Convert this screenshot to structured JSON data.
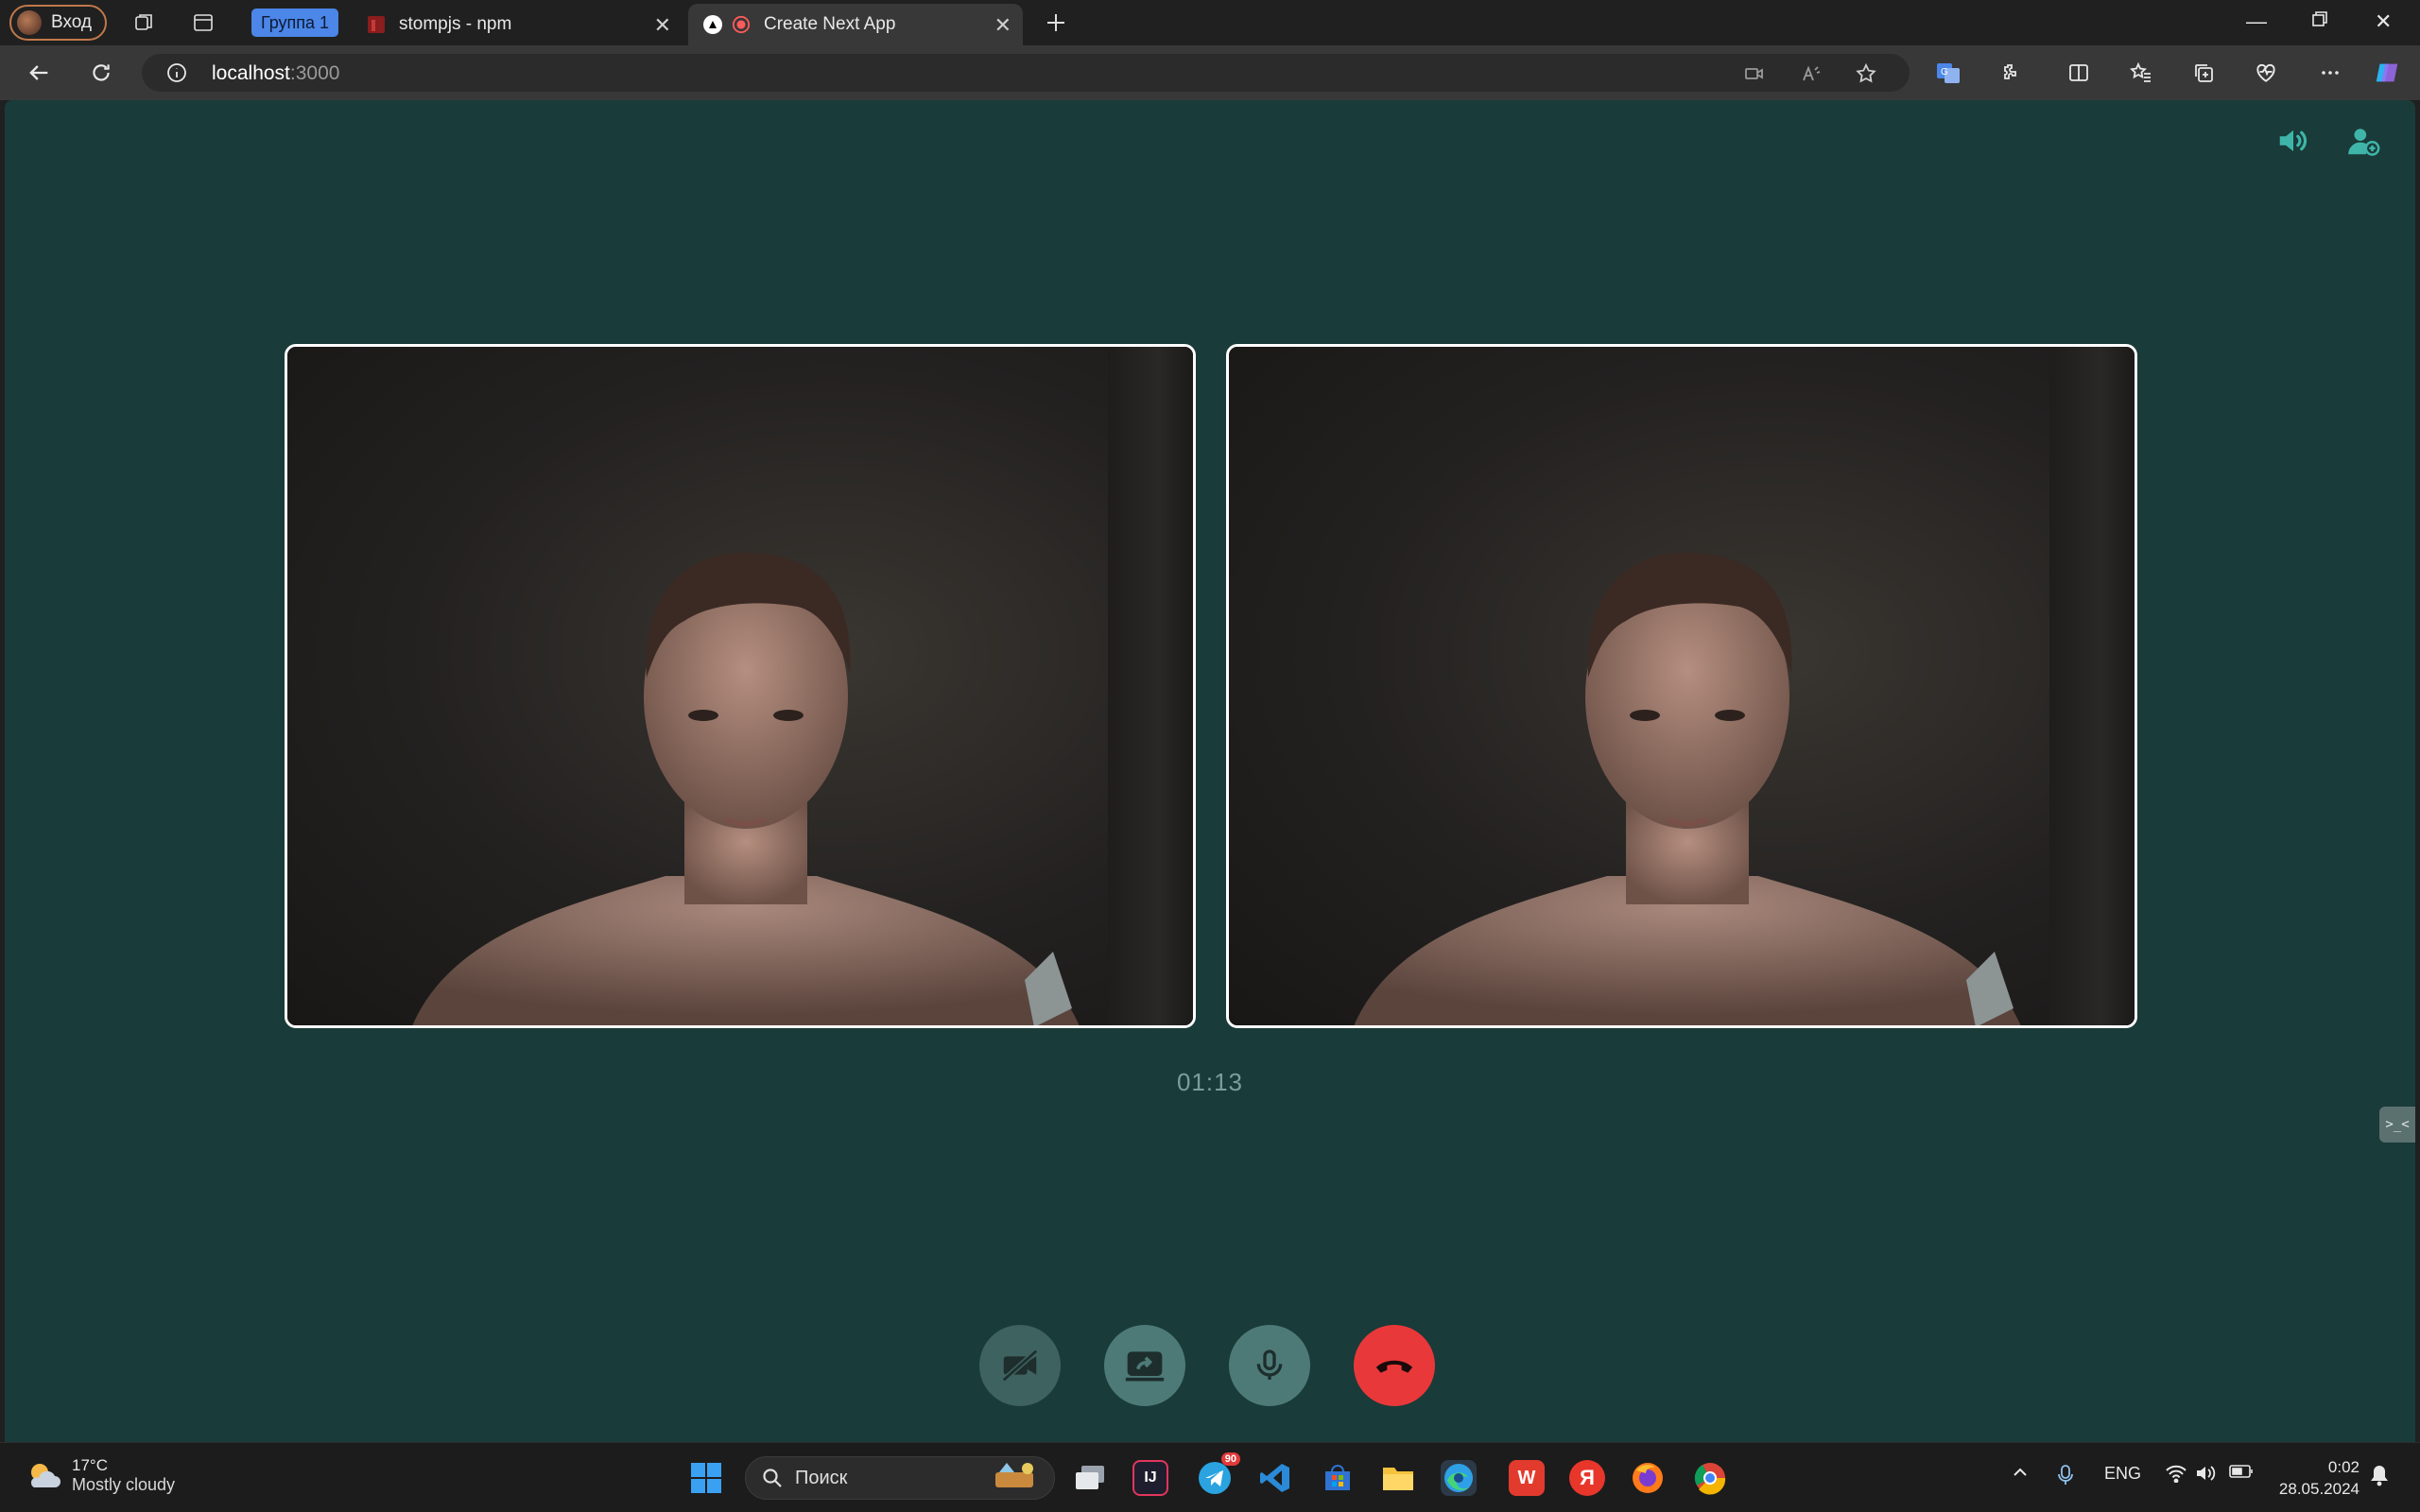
{
  "browser": {
    "profile_label": "Вход",
    "tab_group_label": "Группа 1",
    "tabs": [
      {
        "title": "stompjs - npm",
        "active": false
      },
      {
        "title": "Create Next App",
        "active": true
      }
    ],
    "url_host": "localhost",
    "url_port": ":3000"
  },
  "call": {
    "timer": "01:13",
    "side_tag": ">_<",
    "controls": [
      "camera-off",
      "screen-share",
      "microphone",
      "hang-up"
    ],
    "colors": {
      "background": "#193b39",
      "accent": "#4d7a77",
      "hangup": "#e9383a",
      "icon_teal": "#3fb5a9"
    }
  },
  "taskbar": {
    "weather_temp": "17°C",
    "weather_desc": "Mostly cloudy",
    "search_placeholder": "Поиск",
    "telegram_badge": "90",
    "yandex_label": "Я",
    "language": "ENG",
    "time": "0:02",
    "date": "28.05.2024"
  }
}
